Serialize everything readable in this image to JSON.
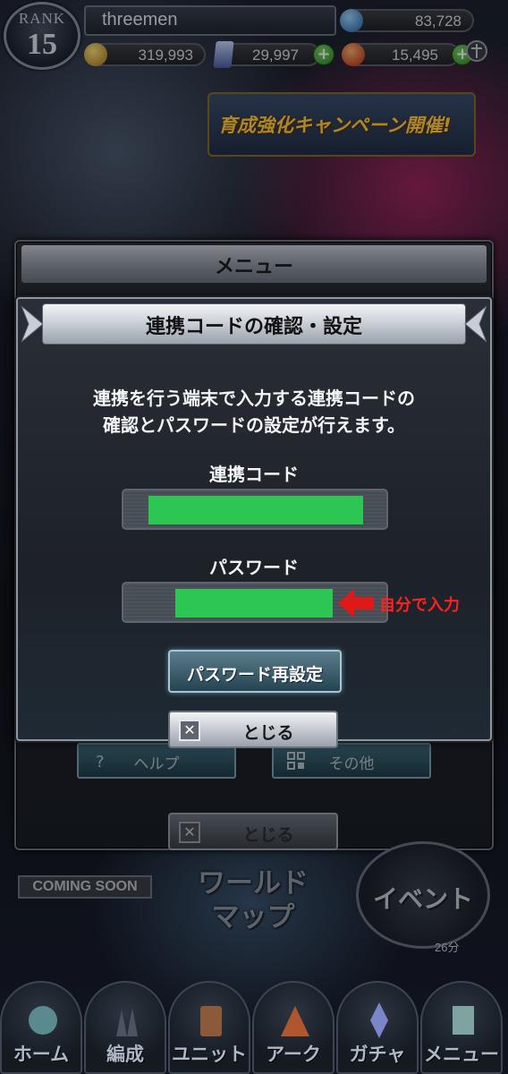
{
  "header": {
    "rank_label": "RANK",
    "rank_value": "15",
    "player_name": "threemen",
    "gem_count": "83,728",
    "gold": "319,993",
    "crystal": "29,997",
    "stamina": "15,495",
    "plus_label": "+"
  },
  "banner": {
    "text": "育成強化キャンペーン開催!"
  },
  "menu": {
    "title": "メニュー",
    "help_label": "ヘルプ",
    "other_label": "その他",
    "close_label": "とじる"
  },
  "home": {
    "coming_soon": "COMING SOON",
    "world_map": "ワールドマップ",
    "event_label": "イベント",
    "event_timer": "26分"
  },
  "nav": {
    "items": [
      {
        "label": "ホーム",
        "icon": "home-icon"
      },
      {
        "label": "編成",
        "icon": "formation-icon"
      },
      {
        "label": "ユニット",
        "icon": "unit-icon"
      },
      {
        "label": "アーク",
        "icon": "ark-icon"
      },
      {
        "label": "ガチャ",
        "icon": "gacha-icon"
      },
      {
        "label": "メニュー",
        "icon": "menu-icon"
      }
    ]
  },
  "dialog": {
    "title": "連携コードの確認・設定",
    "description_line1": "連携を行う端末で入力する連携コードの",
    "description_line2": "確認とパスワードの設定が行えます。",
    "code_label": "連携コード",
    "password_label": "パスワード",
    "reset_button": "パスワード再設定",
    "close_button": "とじる",
    "close_glyph": "✕"
  },
  "annotation": {
    "text": "自分で入力",
    "color": "#ff2020"
  },
  "colors": {
    "redaction": "#2dc653",
    "accent_teal": "#3e6c7d"
  }
}
